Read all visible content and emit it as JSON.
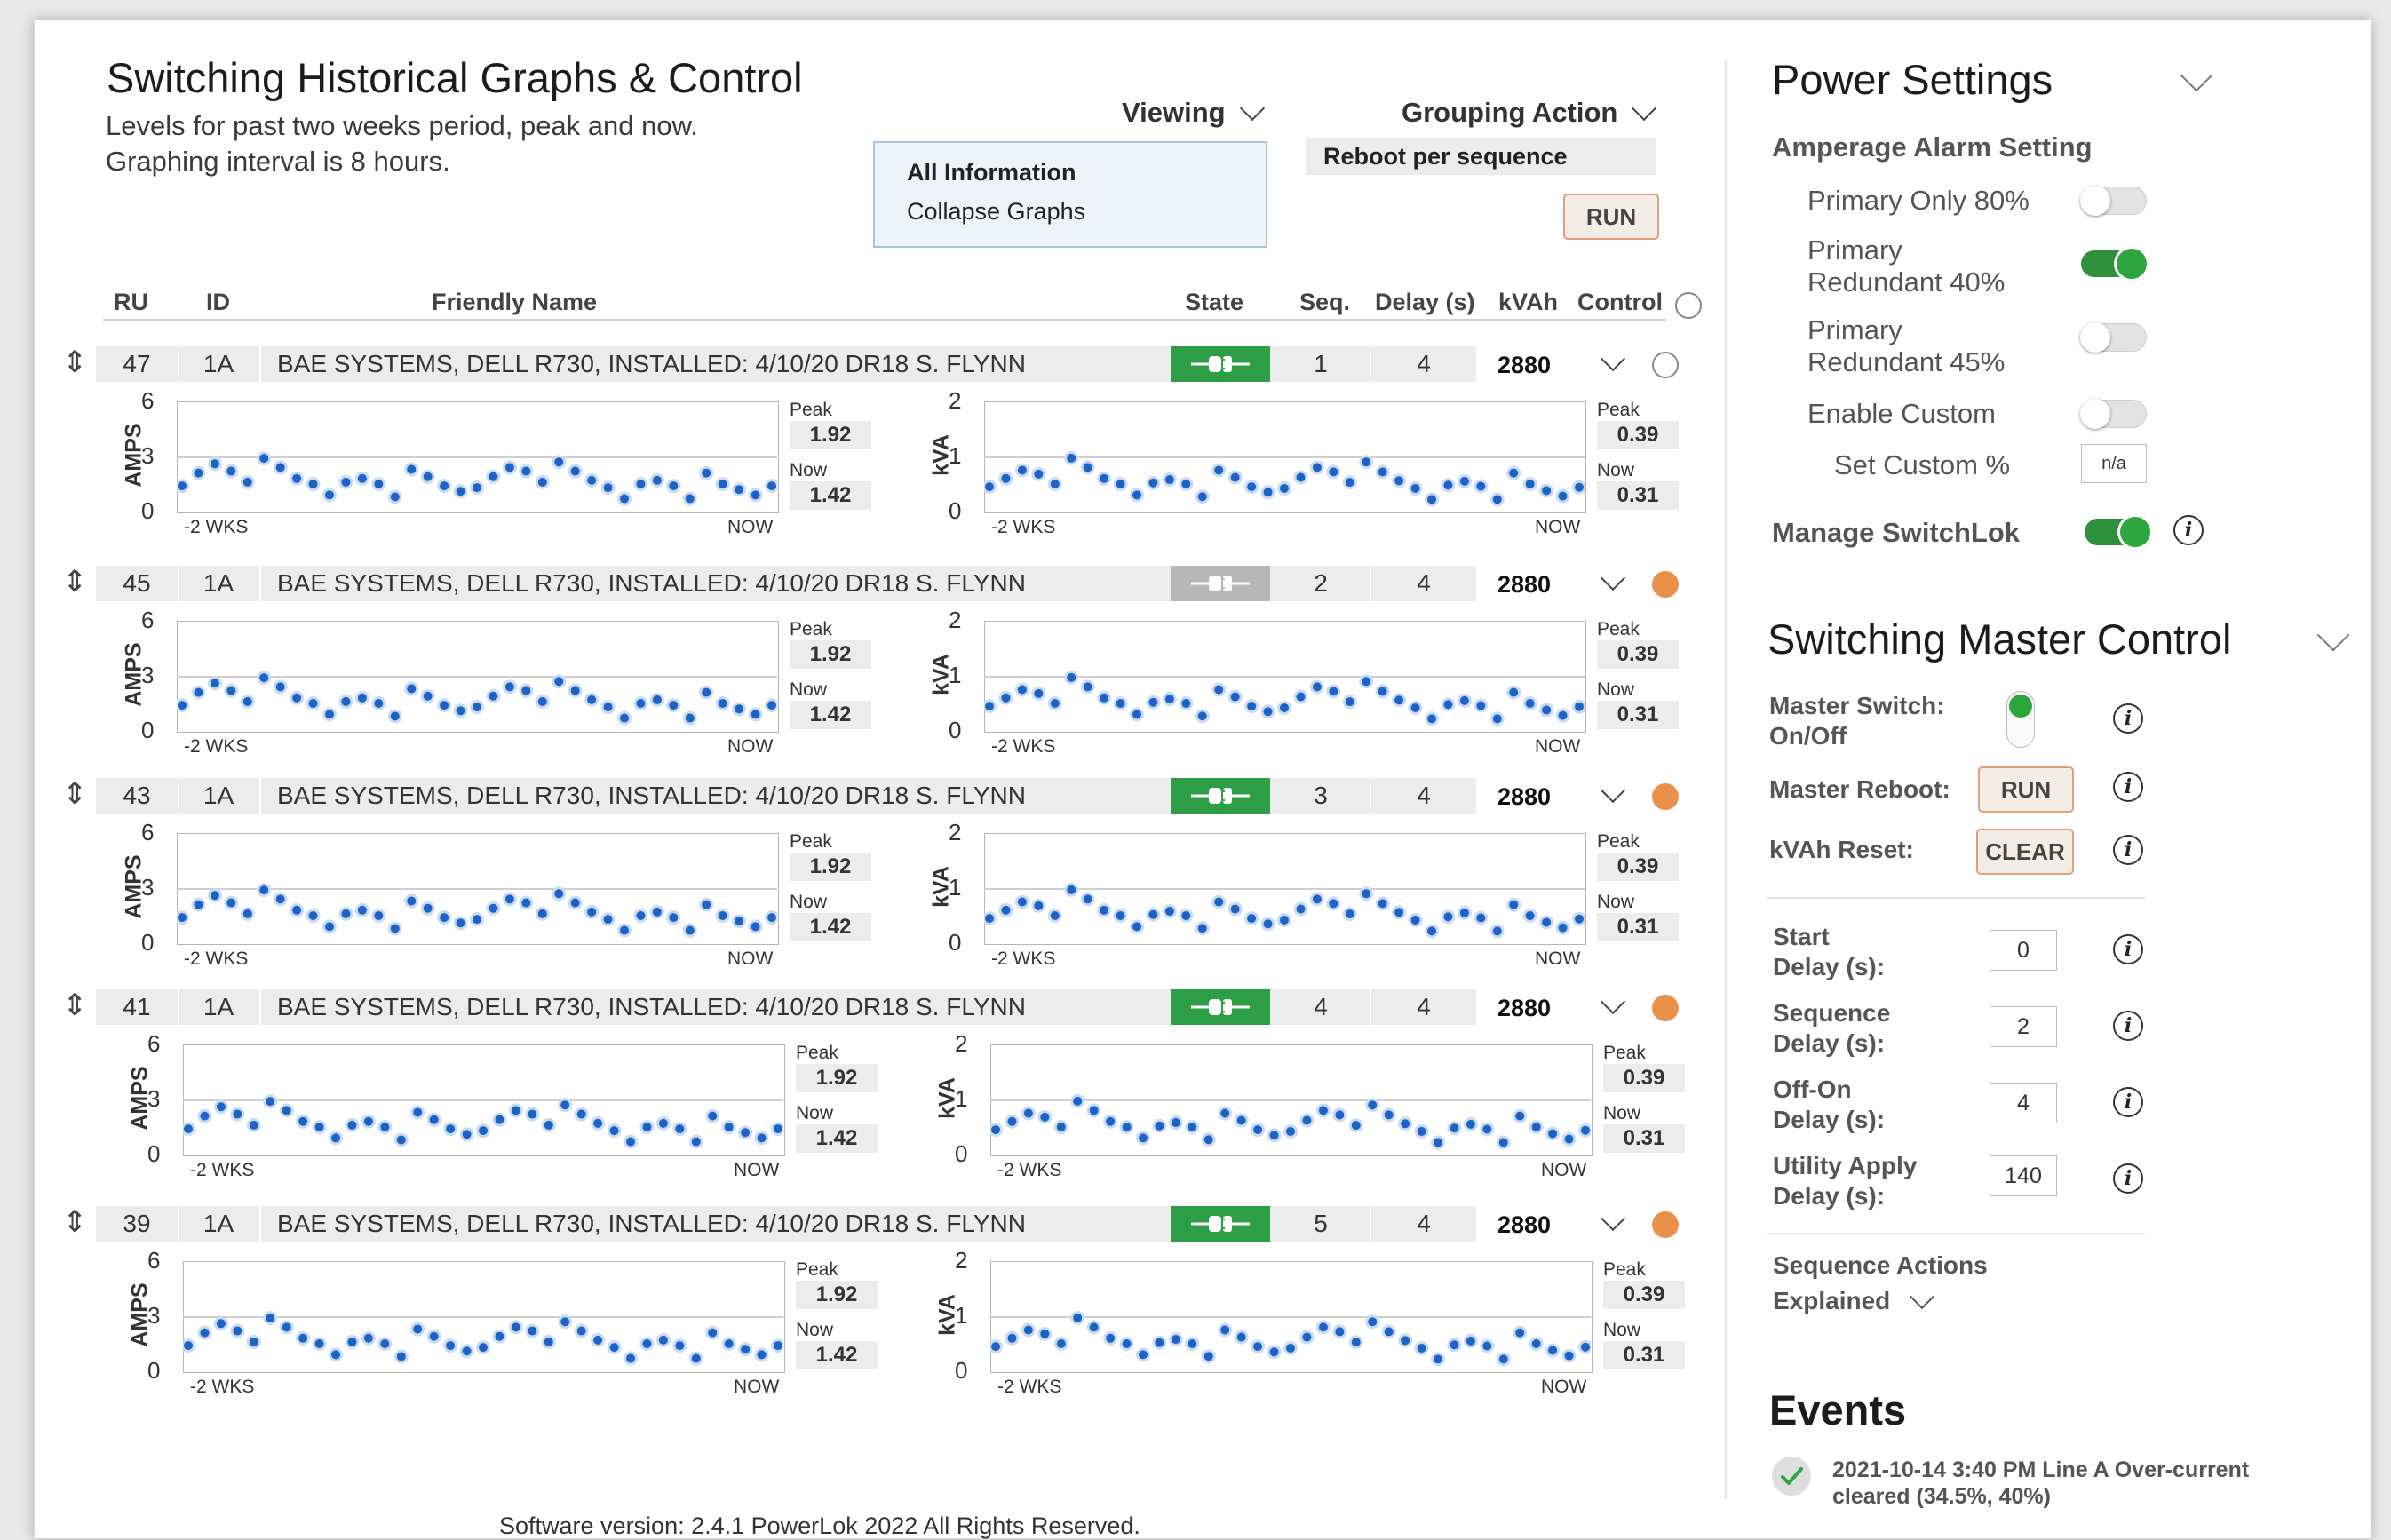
{
  "header": {
    "title": "Switching Historical Graphs & Control",
    "subtitle_line1": "Levels for past two weeks period, peak and now.",
    "subtitle_line2": "Graphing interval is 8 hours."
  },
  "viewing": {
    "label": "Viewing",
    "options": [
      "All Information",
      "Collapse Graphs"
    ]
  },
  "grouping": {
    "label": "Grouping Action",
    "selected": "Reboot per sequence",
    "run_label": "RUN"
  },
  "columns": {
    "ru": "RU",
    "id": "ID",
    "friendly_name": "Friendly Name",
    "state": "State",
    "seq": "Seq.",
    "delay": "Delay (s)",
    "kvah": "kVAh",
    "control": "Control"
  },
  "rows": [
    {
      "ru": "47",
      "id": "1A",
      "name": "BAE SYSTEMS, DELL R730, INSTALLED: 4/10/20 DR18 S. FLYNN",
      "state": "on",
      "seq": "1",
      "delay": "4",
      "kvah": "2880",
      "control": "unselected"
    },
    {
      "ru": "45",
      "id": "1A",
      "name": "BAE SYSTEMS, DELL R730, INSTALLED: 4/10/20 DR18 S. FLYNN",
      "state": "off",
      "seq": "2",
      "delay": "4",
      "kvah": "2880",
      "control": "selected"
    },
    {
      "ru": "43",
      "id": "1A",
      "name": "BAE SYSTEMS, DELL R730, INSTALLED: 4/10/20 DR18 S. FLYNN",
      "state": "on",
      "seq": "3",
      "delay": "4",
      "kvah": "2880",
      "control": "selected"
    },
    {
      "ru": "41",
      "id": "1A",
      "name": "BAE SYSTEMS, DELL R730, INSTALLED: 4/10/20 DR18 S. FLYNN",
      "state": "on",
      "seq": "4",
      "delay": "4",
      "kvah": "2880",
      "control": "selected"
    },
    {
      "ru": "39",
      "id": "1A",
      "name": "BAE SYSTEMS, DELL R730, INSTALLED: 4/10/20 DR18 S. FLYNN",
      "state": "on",
      "seq": "5",
      "delay": "4",
      "kvah": "2880",
      "control": "selected"
    }
  ],
  "graph_labels": {
    "amps_axis": "AMPS",
    "kva_axis": "kVA",
    "amps_ticks": [
      "6",
      "3",
      "0"
    ],
    "kva_ticks": [
      "2",
      "1",
      "0"
    ],
    "x_start": "-2 WKS",
    "x_end": "NOW",
    "peak_label": "Peak",
    "now_label": "Now",
    "amps_peak": "1.92",
    "amps_now": "1.42",
    "kva_peak": "0.39",
    "kva_now": "0.31"
  },
  "chart_data": [
    {
      "type": "scatter",
      "ylabel": "AMPS",
      "ylim": [
        0,
        6
      ],
      "x_range": [
        "-2 WKS",
        "NOW"
      ],
      "values": [
        1.4,
        2.1,
        2.6,
        2.2,
        1.6,
        2.9,
        2.4,
        1.8,
        1.5,
        0.9,
        1.6,
        1.8,
        1.5,
        0.8,
        2.3,
        1.9,
        1.4,
        1.1,
        1.3,
        1.9,
        2.4,
        2.2,
        1.6,
        2.7,
        2.2,
        1.7,
        1.3,
        0.7,
        1.5,
        1.7,
        1.4,
        0.7,
        2.1,
        1.5,
        1.2,
        0.9,
        1.4
      ]
    },
    {
      "type": "scatter",
      "ylabel": "kVA",
      "ylim": [
        0,
        2
      ],
      "x_range": [
        "-2 WKS",
        "NOW"
      ],
      "values": [
        0.45,
        0.6,
        0.75,
        0.68,
        0.5,
        0.97,
        0.8,
        0.6,
        0.5,
        0.3,
        0.52,
        0.58,
        0.5,
        0.27,
        0.75,
        0.62,
        0.45,
        0.35,
        0.42,
        0.62,
        0.8,
        0.72,
        0.53,
        0.9,
        0.72,
        0.56,
        0.42,
        0.22,
        0.48,
        0.55,
        0.46,
        0.22,
        0.7,
        0.5,
        0.38,
        0.28,
        0.44
      ]
    }
  ],
  "power_settings": {
    "title": "Power Settings",
    "alarm_heading": "Amperage Alarm Setting",
    "options": [
      {
        "label_line1": "Primary Only 80%",
        "label_line2": "",
        "on": false
      },
      {
        "label_line1": "Primary",
        "label_line2": "Redundant 40%",
        "on": true
      },
      {
        "label_line1": "Primary",
        "label_line2": "Redundant 45%",
        "on": false
      },
      {
        "label_line1": "Enable Custom",
        "label_line2": "",
        "on": false
      }
    ],
    "set_custom_label": "Set Custom %",
    "set_custom_value": "n/a",
    "manage_switchlok": "Manage SwitchLok"
  },
  "master_control": {
    "title": "Switching Master Control",
    "master_switch_line1": "Master Switch:",
    "master_switch_line2": "On/Off",
    "master_reboot_label": "Master Reboot:",
    "master_reboot_btn": "RUN",
    "kvah_reset_label": "kVAh Reset:",
    "kvah_reset_btn": "CLEAR",
    "delays": [
      {
        "line1": "Start",
        "line2": "Delay (s):",
        "value": "0"
      },
      {
        "line1": "Sequence",
        "line2": "Delay (s):",
        "value": "2"
      },
      {
        "line1": "Off-On",
        "line2": "Delay (s):",
        "value": "4"
      },
      {
        "line1": "Utility Apply",
        "line2": "Delay (s):",
        "value": "140"
      }
    ],
    "sequence_actions_line1": "Sequence Actions",
    "sequence_actions_line2": "Explained"
  },
  "events": {
    "title": "Events",
    "items": [
      {
        "line1": "2021-10-14 3:40 PM Line A Over-current",
        "line2": "cleared (34.5%, 40%)"
      }
    ]
  },
  "footer": {
    "text": "Software version: 2.4.1 PowerLok 2022 All Rights Reserved."
  },
  "colors": {
    "on_green": "#2e9e46",
    "off_grey": "#b7b7b7",
    "selected_orange": "#e9914a",
    "dot_blue": "#1d63c5",
    "btn_border": "#e2a07a"
  },
  "icons": {
    "sort": "sort-arrows-icon",
    "plug": "plug-icon",
    "chevron": "chevron-down-icon",
    "info": "info-icon",
    "check": "check-circle-icon"
  }
}
